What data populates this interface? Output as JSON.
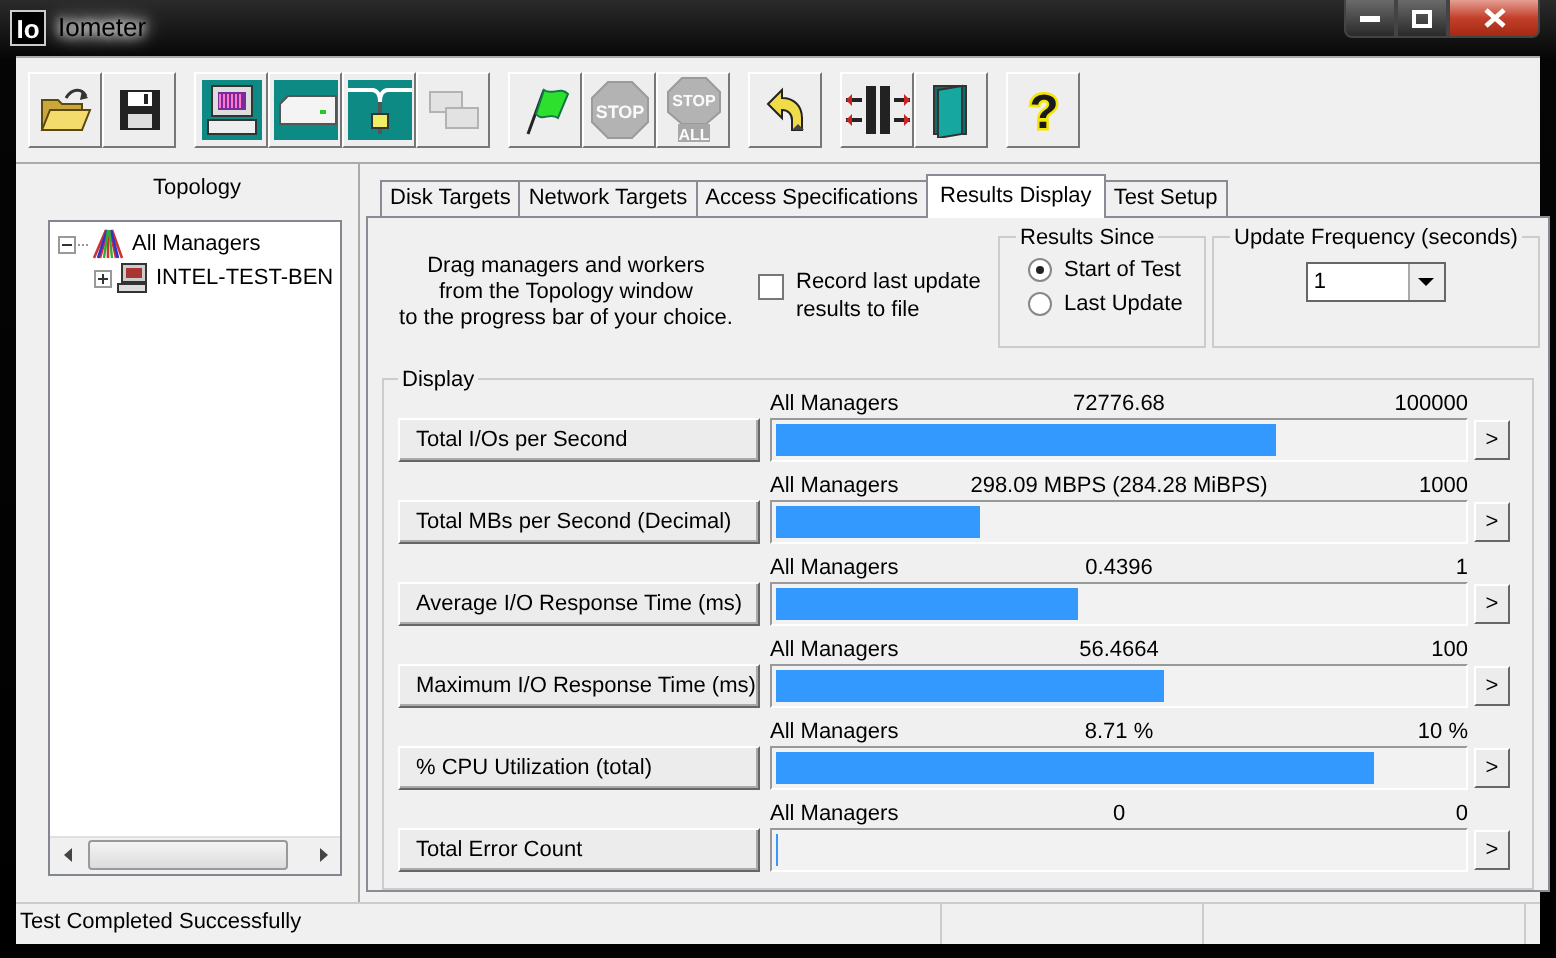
{
  "window": {
    "title": "Iometer",
    "app_icon_text": "Io"
  },
  "toolbar": [
    {
      "kind": "open",
      "disabled": false
    },
    {
      "kind": "save",
      "disabled": false
    },
    {
      "kind": "manager",
      "disabled": false,
      "group_start": true
    },
    {
      "kind": "disk",
      "disabled": false
    },
    {
      "kind": "network",
      "disabled": false
    },
    {
      "kind": "copy",
      "disabled": true
    },
    {
      "kind": "start",
      "disabled": false,
      "group_start": true
    },
    {
      "kind": "stop",
      "text": "STOP",
      "disabled": true
    },
    {
      "kind": "stop_all",
      "text": "STOP",
      "subtext": "ALL",
      "disabled": true
    },
    {
      "kind": "reset",
      "disabled": false,
      "group_start": true
    },
    {
      "kind": "config",
      "disabled": false,
      "group_start": true
    },
    {
      "kind": "exit",
      "disabled": false
    },
    {
      "kind": "help",
      "text": "?",
      "disabled": false,
      "group_start": true
    }
  ],
  "topology": {
    "title": "Topology",
    "tree": [
      {
        "label": "All Managers",
        "kind": "managers",
        "expanded": true,
        "children": [
          {
            "label": "INTEL-TEST-BEN",
            "kind": "computer",
            "expanded": false
          }
        ]
      }
    ]
  },
  "tabs": [
    {
      "label": "Disk Targets",
      "selected": false
    },
    {
      "label": "Network Targets",
      "selected": false
    },
    {
      "label": "Access Specifications",
      "selected": false
    },
    {
      "label": "Results Display",
      "selected": true
    },
    {
      "label": "Test Setup",
      "selected": false
    }
  ],
  "results": {
    "instructions": "Drag managers and workers\nfrom the Topology window\nto the progress bar of your choice.",
    "record": {
      "label": "Record last update\nresults to file",
      "checked": false
    },
    "results_since": {
      "title": "Results Since",
      "options": [
        {
          "label": "Start of Test",
          "selected": true
        },
        {
          "label": "Last Update",
          "selected": false
        }
      ]
    },
    "update_frequency": {
      "title": "Update Frequency (seconds)",
      "value": "1"
    },
    "display": {
      "title": "Display",
      "rows": [
        {
          "metric": "Total I/Os per Second",
          "source": "All Managers",
          "value": "72776.68",
          "max": "100000",
          "level": 0.7278,
          "more": ">"
        },
        {
          "metric": "Total MBs per Second (Decimal)",
          "source": "All Managers",
          "value": "298.09 MBPS (284.28 MiBPS)",
          "max": "1000",
          "level": 0.2981,
          "more": ">"
        },
        {
          "metric": "Average I/O Response Time (ms)",
          "source": "All Managers",
          "value": "0.4396",
          "max": "1",
          "level": 0.4396,
          "more": ">"
        },
        {
          "metric": "Maximum I/O Response Time (ms)",
          "source": "All Managers",
          "value": "56.4664",
          "max": "100",
          "level": 0.5647,
          "more": ">"
        },
        {
          "metric": "% CPU Utilization (total)",
          "source": "All Managers",
          "value": "8.71 %",
          "max": "10 %",
          "level": 0.871,
          "more": ">"
        },
        {
          "metric": "Total Error Count",
          "source": "All Managers",
          "value": "0",
          "max": "0",
          "level": 0,
          "more": ">"
        }
      ]
    }
  },
  "status_bar": {
    "message": "Test Completed Successfully"
  }
}
